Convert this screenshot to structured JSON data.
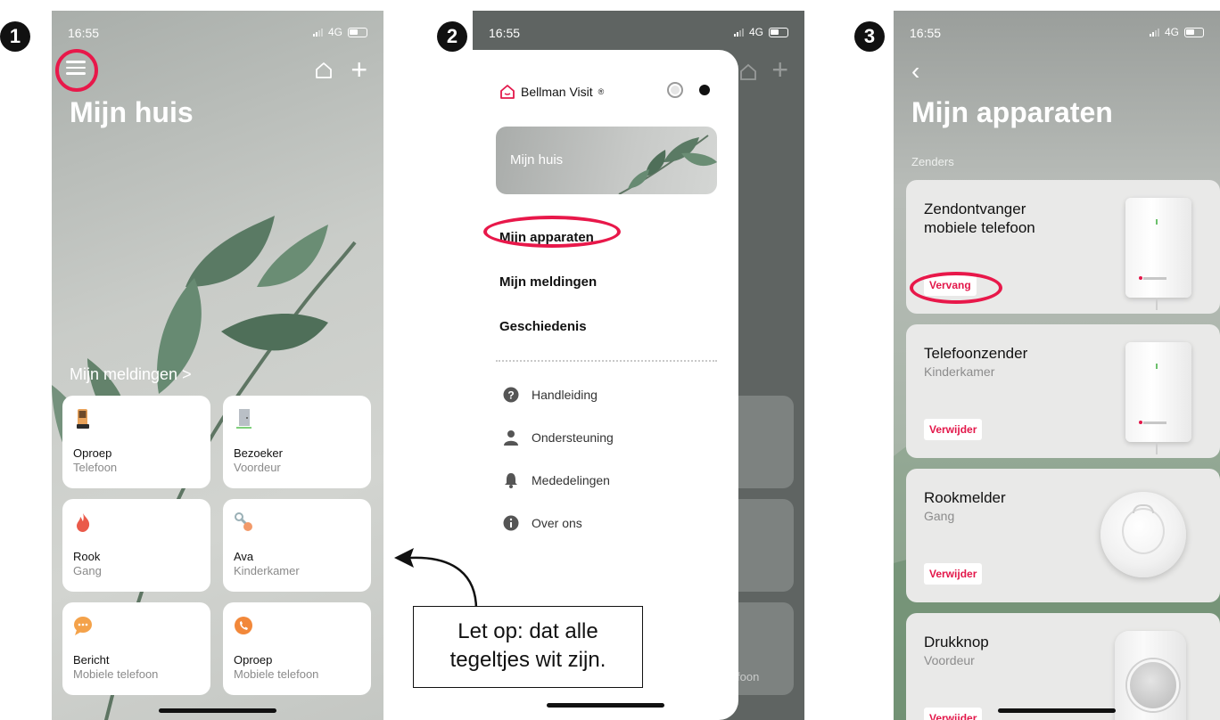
{
  "steps": [
    "1",
    "2",
    "3"
  ],
  "status": {
    "time": "16:55",
    "network": "4G"
  },
  "phone1": {
    "title": "Mijn huis",
    "notifications_link": "Mijn meldingen",
    "tiles": [
      {
        "title": "Oproep",
        "subtitle": "Telefoon",
        "icon": "phone-handset-icon"
      },
      {
        "title": "Bezoeker",
        "subtitle": "Voordeur",
        "icon": "door-icon"
      },
      {
        "title": "Rook",
        "subtitle": "Gang",
        "icon": "flame-icon"
      },
      {
        "title": "Ava",
        "subtitle": "Kinderkamer",
        "icon": "pacifier-icon"
      },
      {
        "title": "Bericht",
        "subtitle": "Mobiele telefoon",
        "icon": "chat-bubble-icon"
      },
      {
        "title": "Oproep",
        "subtitle": "Mobiele telefoon",
        "icon": "phone-circle-icon"
      }
    ]
  },
  "phone2": {
    "brand": "Bellman Visit",
    "brand_mark": "®",
    "hero": "Mijn huis",
    "main_items": [
      "Mijn apparaten",
      "Mijn meldingen",
      "Geschiedenis"
    ],
    "sub_items": [
      {
        "label": "Handleiding",
        "icon": "question-circle-icon"
      },
      {
        "label": "Ondersteuning",
        "icon": "person-icon"
      },
      {
        "label": "Mededelingen",
        "icon": "bell-icon"
      },
      {
        "label": "Over ons",
        "icon": "info-circle-icon"
      }
    ],
    "behind_text": "foon"
  },
  "callout": {
    "line1": "Let op: dat alle",
    "line2": "tegeltjes wit zijn."
  },
  "phone3": {
    "title": "Mijn apparaten",
    "section": "Zenders",
    "devices": [
      {
        "title": "Zendontvanger mobiele telefoon",
        "subtitle": "",
        "button": "Vervang"
      },
      {
        "title": "Telefoonzender",
        "subtitle": "Kinderkamer",
        "button": "Verwijder"
      },
      {
        "title": "Rookmelder",
        "subtitle": "Gang",
        "button": "Verwijder"
      },
      {
        "title": "Drukknop",
        "subtitle": "Voordeur",
        "button": "Verwijder"
      }
    ]
  },
  "colors": {
    "accent": "#e8184a",
    "tile_bg": "#ffffff",
    "card_bg": "#e9e9e8"
  }
}
